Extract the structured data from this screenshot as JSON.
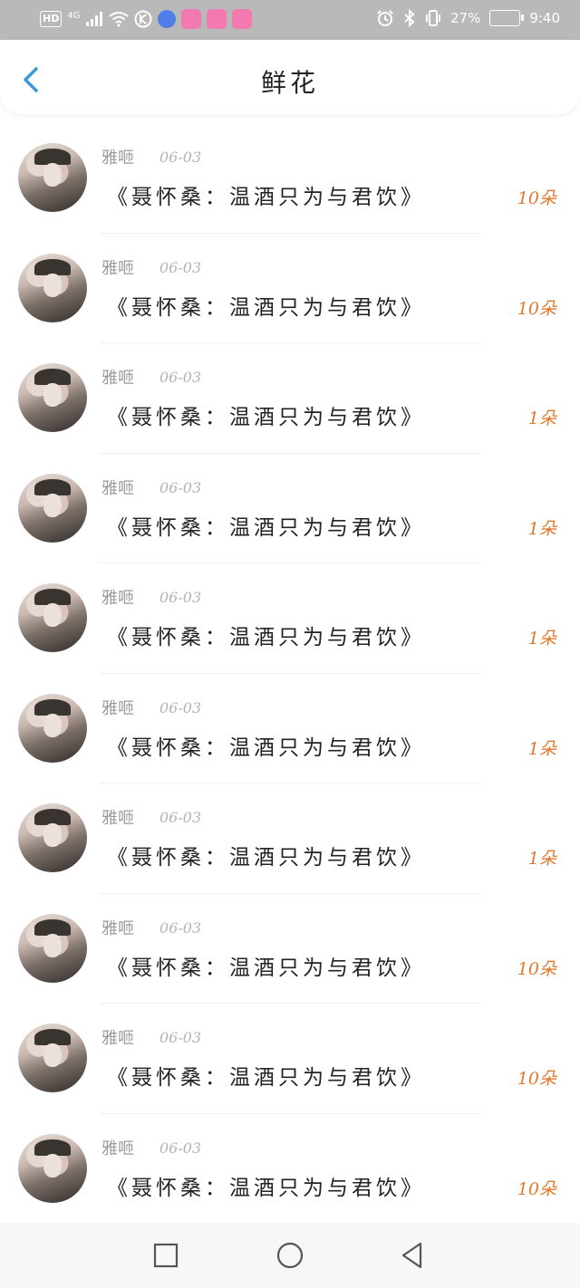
{
  "status_bar": {
    "left_labels": [
      "HD",
      "4G"
    ],
    "right_labels": [
      "27%",
      "9:40"
    ],
    "icons": [
      "signal-icon",
      "wifi-icon",
      "k-icon",
      "music-icon",
      "app-icon",
      "app-icon",
      "app-icon",
      "alarm-icon",
      "bluetooth-icon",
      "vibrate-icon",
      "battery-icon"
    ]
  },
  "header": {
    "title": "鲜花",
    "back_icon": "chevron-left-icon",
    "accent": "#3a9bdc"
  },
  "list": {
    "items": [
      {
        "user": "雅咂",
        "date": "06-03",
        "text": "《聂怀桑：温酒只为与君饮》",
        "count": "10朵"
      },
      {
        "user": "雅咂",
        "date": "06-03",
        "text": "《聂怀桑：温酒只为与君饮》",
        "count": "10朵"
      },
      {
        "user": "雅咂",
        "date": "06-03",
        "text": "《聂怀桑：温酒只为与君饮》",
        "count": "1朵"
      },
      {
        "user": "雅咂",
        "date": "06-03",
        "text": "《聂怀桑：温酒只为与君饮》",
        "count": "1朵"
      },
      {
        "user": "雅咂",
        "date": "06-03",
        "text": "《聂怀桑：温酒只为与君饮》",
        "count": "1朵"
      },
      {
        "user": "雅咂",
        "date": "06-03",
        "text": "《聂怀桑：温酒只为与君饮》",
        "count": "1朵"
      },
      {
        "user": "雅咂",
        "date": "06-03",
        "text": "《聂怀桑：温酒只为与君饮》",
        "count": "1朵"
      },
      {
        "user": "雅咂",
        "date": "06-03",
        "text": "《聂怀桑：温酒只为与君饮》",
        "count": "10朵"
      },
      {
        "user": "雅咂",
        "date": "06-03",
        "text": "《聂怀桑：温酒只为与君饮》",
        "count": "10朵"
      },
      {
        "user": "雅咂",
        "date": "06-03",
        "text": "《聂怀桑：温酒只为与君饮》",
        "count": "10朵"
      }
    ],
    "count_color": "#e0792d"
  },
  "nav_bar": {
    "icons": [
      "recent-apps-icon",
      "home-icon",
      "back-icon"
    ]
  }
}
